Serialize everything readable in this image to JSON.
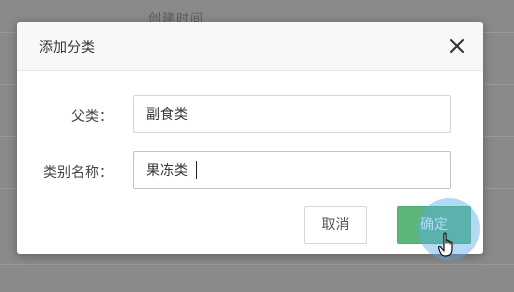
{
  "background": {
    "header_text": "创建时间"
  },
  "dialog": {
    "title": "添加分类",
    "close_icon": "close-icon",
    "fields": [
      {
        "label": "父类：",
        "value": "副食类"
      },
      {
        "label": "类别名称：",
        "value": "果冻类"
      }
    ],
    "cancel_label": "取消",
    "ok_label": "确定"
  },
  "colors": {
    "accent_green": "#5cb67c",
    "click_highlight": "#5aaae6"
  }
}
